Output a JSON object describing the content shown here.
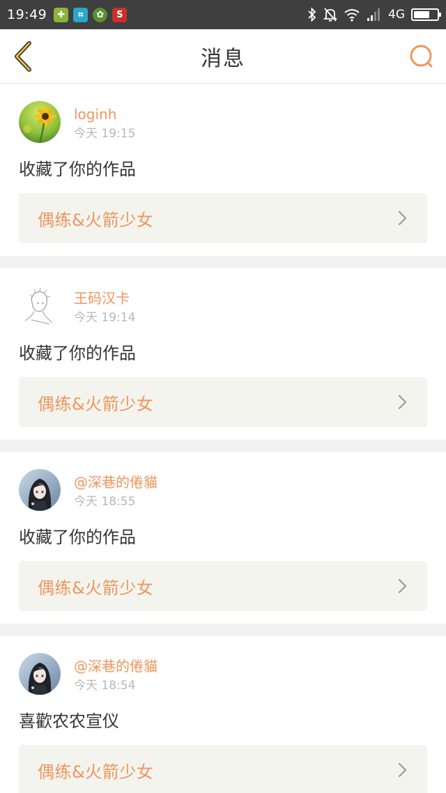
{
  "status_bar": {
    "time": "19:49",
    "network": "4G",
    "battery_level": 0.7,
    "icons": [
      "app-icon-green",
      "crop-icon",
      "settings-app-icon",
      "red-app-icon",
      "bluetooth-icon",
      "notifications-off-icon",
      "wifi-icon",
      "signal-icon",
      "battery-icon"
    ]
  },
  "nav": {
    "title": "消息",
    "accent": "#f0955a",
    "back_icon": "chevron-left-icon",
    "search_icon": "search-icon"
  },
  "messages": [
    {
      "username": "loginh",
      "time": "今天 19:15",
      "action": "收藏了你的作品",
      "work_title": "偶练&火箭少女",
      "avatar": "sunflower-avatar"
    },
    {
      "username": "王码汉卡",
      "time": "今天 19:14",
      "action": "收藏了你的作品",
      "work_title": "偶练&火箭少女",
      "avatar": "sketch-avatar"
    },
    {
      "username": "@深巷的倦貓",
      "time": "今天 18:55",
      "action": "收藏了你的作品",
      "work_title": "偶练&火箭少女",
      "avatar": "anime-girl-avatar"
    },
    {
      "username": "@深巷的倦貓",
      "time": "今天 18:54",
      "action": "喜歡农农宣仪",
      "work_title": "偶练&火箭少女",
      "avatar": "anime-girl-avatar"
    }
  ]
}
